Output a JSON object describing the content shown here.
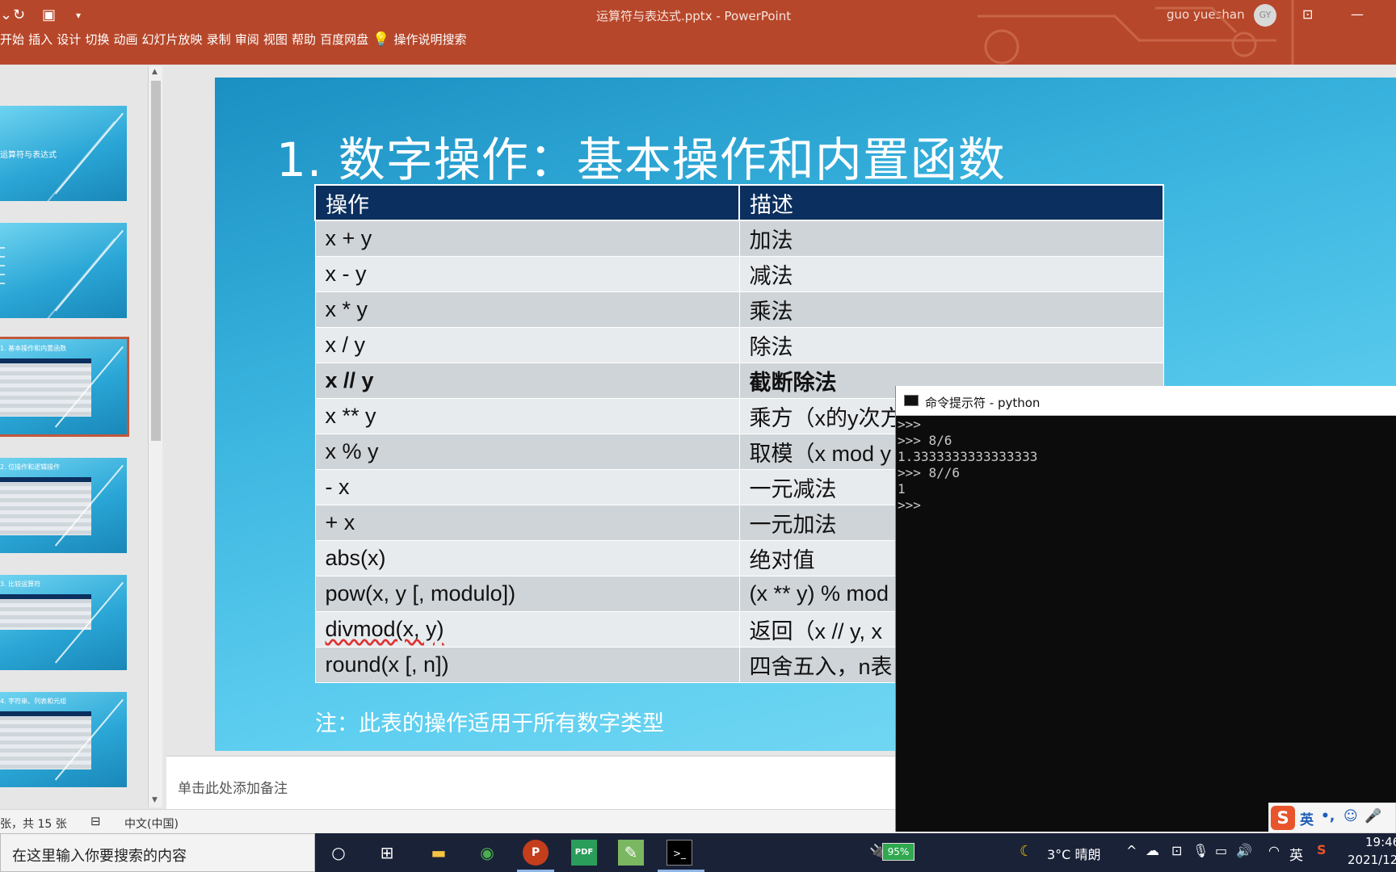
{
  "window": {
    "title": "运算符与表达式.pptx  -  PowerPoint",
    "user_name": "guo yueshan",
    "user_initials": "GY",
    "qa_icons": [
      "undo-icon",
      "redo-icon",
      "slideshow-icon",
      "customize-icon"
    ]
  },
  "ribbon": {
    "tabs": [
      "开始",
      "插入",
      "设计",
      "切换",
      "动画",
      "幻灯片放映",
      "录制",
      "审阅",
      "视图",
      "帮助",
      "百度网盘"
    ],
    "tell_me": "操作说明搜索"
  },
  "thumbnails": [
    {
      "label": "运算符与表达式"
    },
    {
      "label": ""
    },
    {
      "label": "1. 基本操作和内置函数"
    },
    {
      "label": "2. 位操作和逻辑操作"
    },
    {
      "label": "3. 比较运算符"
    },
    {
      "label": "4. 字符串、列表和元组"
    }
  ],
  "slide": {
    "title": "1. 数字操作：基本操作和内置函数",
    "table": {
      "headers": [
        "操作",
        "描述"
      ],
      "rows": [
        [
          "x + y",
          "加法"
        ],
        [
          "x - y",
          "减法"
        ],
        [
          "x * y",
          "乘法"
        ],
        [
          "x / y",
          "除法"
        ],
        [
          "x // y",
          "截断除法"
        ],
        [
          "x ** y",
          "乘方（x的y次方"
        ],
        [
          "x % y",
          "取模（x mod y"
        ],
        [
          "- x",
          "一元减法"
        ],
        [
          "+ x",
          "一元加法"
        ],
        [
          "abs(x)",
          "绝对值"
        ],
        [
          "pow(x, y [, modulo])",
          "(x ** y) % mod"
        ],
        [
          "divmod(x, y)",
          "返回（x // y, x"
        ],
        [
          "round(x [, n])",
          "四舍五入，n表"
        ]
      ]
    },
    "note": "注：此表的操作适用于所有数字类型"
  },
  "notes_placeholder": "单击此处添加备注",
  "status": {
    "slide_count": "张，共 15 张",
    "language": "中文(中国)"
  },
  "console": {
    "title": "命令提示符 - python",
    "lines": [
      ">>>",
      ">>> 8/6",
      "1.3333333333333333",
      ">>> 8//6",
      "1",
      ">>>"
    ]
  },
  "ime": {
    "mode": "英",
    "punct": "•,"
  },
  "taskbar": {
    "search_placeholder": "在这里输入你要搜索的内容",
    "battery": "95%",
    "weather": "3°C  晴朗",
    "lang": "英",
    "time": "19:46",
    "date": "2021/12"
  },
  "colors": {
    "accent": "#b7472a",
    "table_header": "#0b2f5e",
    "taskbar": "#1a2238"
  }
}
